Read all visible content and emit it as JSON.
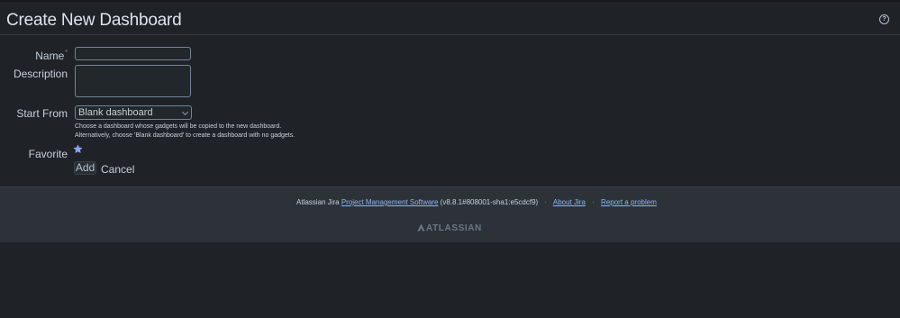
{
  "page": {
    "title": "Create New Dashboard"
  },
  "header": {
    "help_icon": "help-circle-icon",
    "help_glyph": "?"
  },
  "form": {
    "name_label": "Name",
    "required_marker": "*",
    "name_value": "",
    "description_label": "Description",
    "description_value": "",
    "start_from_label": "Start From",
    "start_from_selected": "Blank dashboard",
    "help_text_1": "Choose a dashboard whose gadgets will be copied to the new dashboard.",
    "help_text_2": "Alternatively, choose 'Blank dashboard' to create a dashboard with no gadgets.",
    "favorite_label": "Favorite",
    "favorite_icon": "star-icon",
    "favorite_selected": true,
    "add_button": "Add",
    "cancel_button": "Cancel"
  },
  "footer": {
    "prefix": "Atlassian Jira",
    "link_pms": "Project Management Software",
    "version": "(v8.8.1#808001-sha1:e5cdcf9)",
    "separator": "·",
    "link_about": "About Jira",
    "link_report": "Report a problem",
    "brand": "ATLASSIAN"
  },
  "colors": {
    "background": "#1f2227",
    "footer_bg": "#2c3238",
    "link": "#85b8ff",
    "star": "#8aa2ff"
  }
}
